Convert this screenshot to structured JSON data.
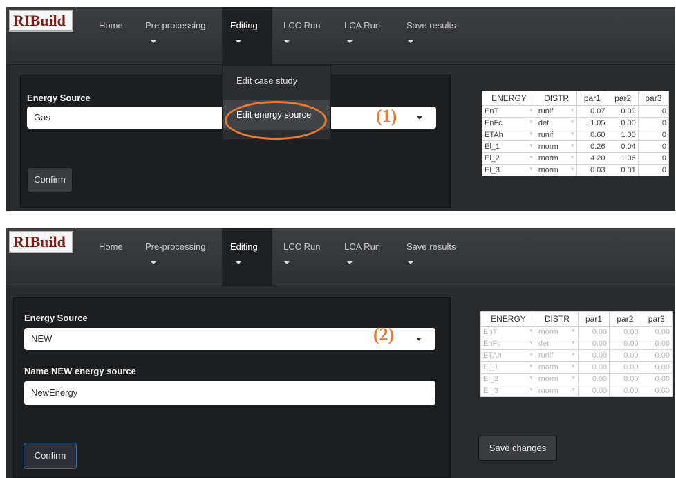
{
  "nav": {
    "logo": "RIBuild",
    "items": [
      {
        "label": "Home"
      },
      {
        "label": "Pre-processing"
      },
      {
        "label": "Editing"
      },
      {
        "label": "LCC Run"
      },
      {
        "label": "LCA Run"
      },
      {
        "label": "Save results"
      }
    ],
    "dropdown": [
      "Edit case study",
      "Edit energy source"
    ]
  },
  "colors": {
    "annotation": "#e87a33",
    "navbar": "#35373a",
    "card": "#1d1e20"
  },
  "table": {
    "headers": [
      "ENERGY",
      "DISTR",
      "par1",
      "par2",
      "par3"
    ]
  },
  "panel1": {
    "energy_source_label": "Energy Source",
    "energy_source_value": "Gas",
    "confirm": "Confirm",
    "annotation": "(1)",
    "rows": [
      [
        "EnT",
        "runif",
        "0.07",
        "0.09",
        "0"
      ],
      [
        "EnFc",
        "det",
        "1.05",
        "0.00",
        "0"
      ],
      [
        "ETAh",
        "runif",
        "0.60",
        "1.00",
        "0"
      ],
      [
        "El_1",
        "rnorm",
        "0.26",
        "0.04",
        "0"
      ],
      [
        "El_2",
        "rnorm",
        "4.20",
        "1.06",
        "0"
      ],
      [
        "El_3",
        "rnorm",
        "0.03",
        "0.01",
        "0"
      ]
    ]
  },
  "panel2": {
    "energy_source_label": "Energy Source",
    "energy_source_value": "NEW",
    "name_label": "Name NEW energy source",
    "name_value": "NewEnergy",
    "confirm": "Confirm",
    "save_changes": "Save changes",
    "annotation": "(2)",
    "rows": [
      [
        "EnT",
        "rnorm",
        "0.00",
        "0.00",
        "0.00"
      ],
      [
        "EnFc",
        "det",
        "0.00",
        "0.00",
        "0.00"
      ],
      [
        "ETAh",
        "runif",
        "0.00",
        "0.00",
        "0.00"
      ],
      [
        "El_1",
        "rnorm",
        "0.00",
        "0.00",
        "0.00"
      ],
      [
        "El_2",
        "rnorm",
        "0.00",
        "0.00",
        "0.00"
      ],
      [
        "El_3",
        "rnorm",
        "0.00",
        "0.00",
        "0.00"
      ]
    ]
  }
}
